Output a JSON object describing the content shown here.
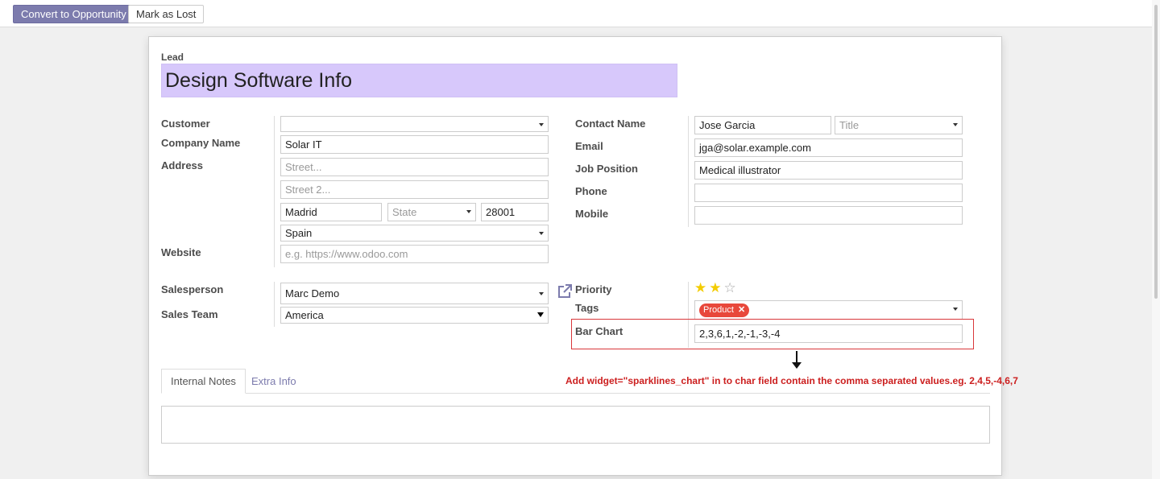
{
  "control_bar": {
    "convert_label": "Convert to Opportunity",
    "lost_label": "Mark as Lost"
  },
  "lead": {
    "label": "Lead",
    "title": "Design Software Info"
  },
  "left_fields": {
    "customer_label": "Customer",
    "customer_value": "",
    "company_label": "Company Name",
    "company_value": "Solar IT",
    "address_label": "Address",
    "street_placeholder": "Street...",
    "street2_placeholder": "Street 2...",
    "city_value": "Madrid",
    "state_placeholder": "State",
    "zip_value": "28001",
    "country_value": "Spain",
    "website_label": "Website",
    "website_placeholder": "e.g. https://www.odoo.com",
    "salesperson_label": "Salesperson",
    "salesperson_value": "Marc Demo",
    "team_label": "Sales Team",
    "team_value": "America"
  },
  "right_fields": {
    "contact_label": "Contact Name",
    "contact_value": "Jose Garcia",
    "title_placeholder": "Title",
    "email_label": "Email",
    "email_value": "jga@solar.example.com",
    "job_label": "Job Position",
    "job_value": "Medical illustrator",
    "phone_label": "Phone",
    "phone_value": "",
    "mobile_label": "Mobile",
    "mobile_value": "",
    "priority_label": "Priority",
    "priority_stars": 2,
    "priority_max": 3,
    "tags_label": "Tags",
    "tag_value": "Product",
    "barchart_label": "Bar Chart",
    "barchart_value": "2,3,6,1,-2,-1,-3,-4"
  },
  "annotation": {
    "hint": "Add widget=\"sparklines_chart\" in to char field contain the comma separated values.eg. 2,4,5,-4,6,7"
  },
  "tabs": {
    "internal_notes": "Internal Notes",
    "extra_info": "Extra Info"
  },
  "colors": {
    "primary": "#7c7bad",
    "title_bg": "#d7c8fb",
    "tag_bg": "#e8483b",
    "star": "#f3cc00",
    "annotation": "#cc1f1f"
  }
}
